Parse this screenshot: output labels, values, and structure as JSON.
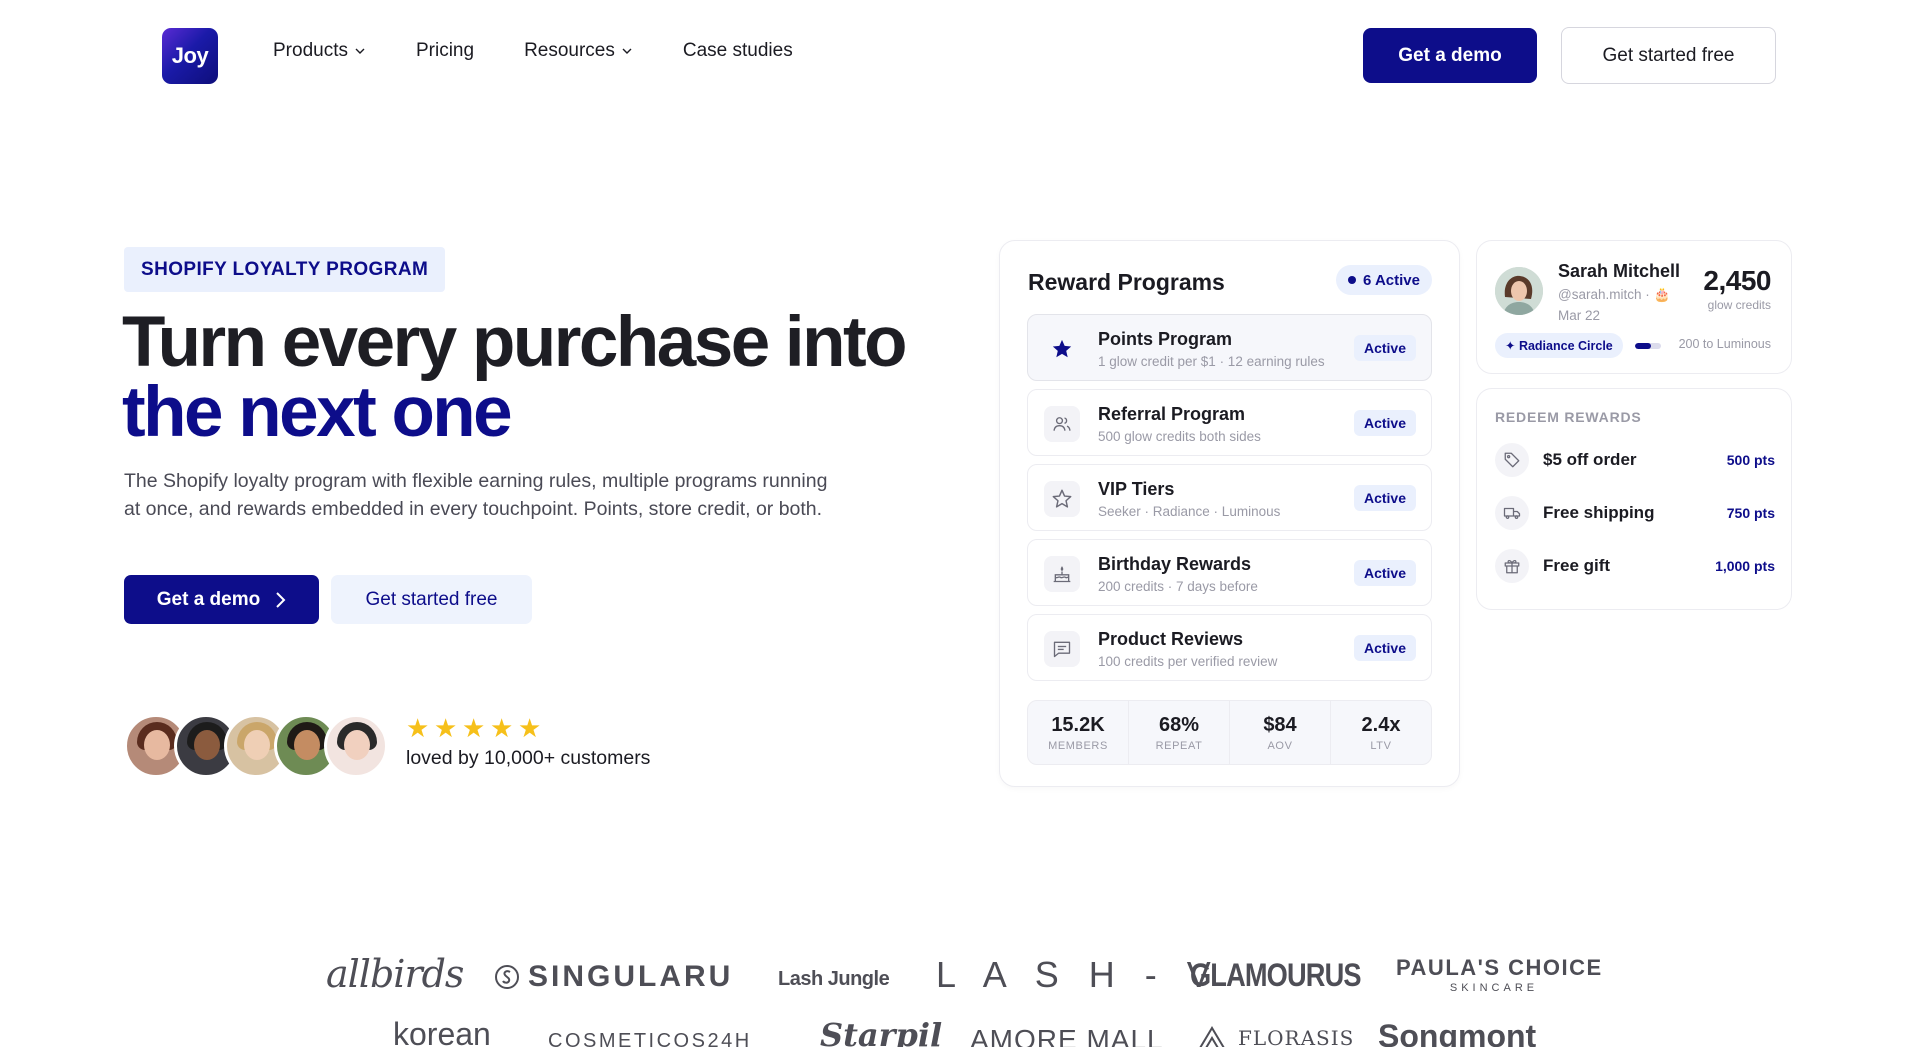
{
  "nav": {
    "logo_text": "Joy",
    "links": [
      {
        "label": "Products",
        "has_menu": true
      },
      {
        "label": "Pricing",
        "has_menu": false
      },
      {
        "label": "Resources",
        "has_menu": true
      },
      {
        "label": "Case studies",
        "has_menu": false
      }
    ],
    "demo_label": "Get a demo",
    "start_label": "Get started free"
  },
  "hero": {
    "eyebrow": "SHOPIFY LOYALTY PROGRAM",
    "headline_line1": "Turn every purchase into",
    "headline_line2": "the next one",
    "subtext": "The Shopify loyalty program with flexible earning rules, multiple programs running at once, and rewards embedded in every touchpoint. Points, store credit, or both.",
    "demo_label": "Get a demo",
    "start_label": "Get started free",
    "rating_stars": 5,
    "social_proof": "loved by 10,000+ customers"
  },
  "reward_programs": {
    "title": "Reward Programs",
    "badge": "6 Active",
    "programs": [
      {
        "name": "Points Program",
        "desc": "1 glow credit per $1 · 12 earning rules",
        "status": "Active",
        "icon": "star-icon"
      },
      {
        "name": "Referral Program",
        "desc": "500 glow credits both sides",
        "status": "Active",
        "icon": "users-icon"
      },
      {
        "name": "VIP Tiers",
        "desc": "Seeker · Radiance · Luminous",
        "status": "Active",
        "icon": "star-outline-icon"
      },
      {
        "name": "Birthday Rewards",
        "desc": "200 credits · 7 days before",
        "status": "Active",
        "icon": "cake-icon"
      },
      {
        "name": "Product Reviews",
        "desc": "100 credits per verified review",
        "status": "Active",
        "icon": "message-icon"
      }
    ],
    "stats": [
      {
        "value": "15.2K",
        "label": "MEMBERS"
      },
      {
        "value": "68%",
        "label": "REPEAT"
      },
      {
        "value": "$84",
        "label": "AOV"
      },
      {
        "value": "2.4x",
        "label": "LTV"
      }
    ]
  },
  "member": {
    "name": "Sarah Mitchell",
    "handle": "@sarah.mitch · 🎂",
    "date": "Mar 22",
    "points": "2,450",
    "points_label": "glow credits",
    "tier": "✦ Radiance Circle",
    "tier_progress": 0.6,
    "tier_next": "200 to Luminous"
  },
  "redeem": {
    "title": "REDEEM REWARDS",
    "items": [
      {
        "label": "$5 off order",
        "points": "500 pts",
        "icon": "tag-icon"
      },
      {
        "label": "Free shipping",
        "points": "750 pts",
        "icon": "truck-icon"
      },
      {
        "label": "Free gift",
        "points": "1,000 pts",
        "icon": "gift-icon"
      }
    ]
  },
  "brand_logos": {
    "row1": [
      "allbirds",
      "SINGULARU",
      "Lash Jungle",
      "L A S H - V",
      "GLAMOURUS",
      "PAULA'S CHOICE",
      "SKINCARE"
    ],
    "row2": [
      "korean",
      "COSMETICOS24H",
      "Starpil",
      "AMORE MALL",
      "FLORASIS",
      "Songmont"
    ]
  },
  "colors": {
    "brand_navy": "#0d0d8a",
    "badge_bg": "#eaf0fd",
    "star_yellow": "#f6c01a"
  }
}
